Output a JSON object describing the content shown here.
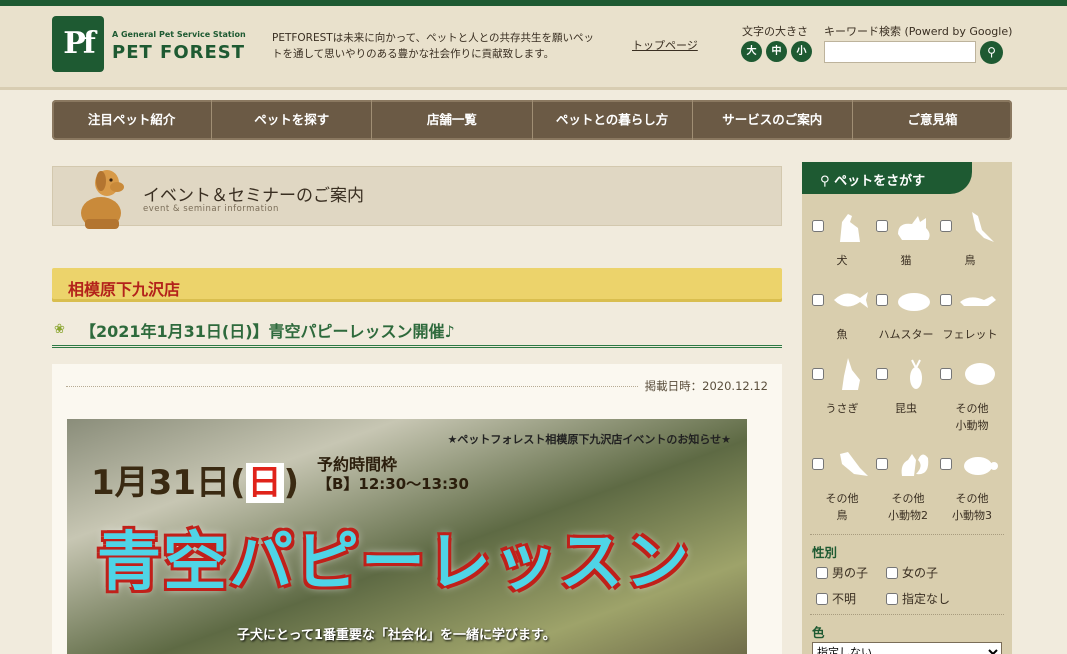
{
  "header": {
    "logo_tag": "A General Pet Service Station",
    "logo_name": "PET FOREST",
    "logo_mark": "Pf",
    "tagline": "PETFORESTは未来に向かって、ペットと人との共存共生を願いペットを通して思いやりのある豊かな社会作りに貢献致します。",
    "top_link": "トップページ",
    "font_size_label": "文字の大きさ",
    "font_sizes": [
      "大",
      "中",
      "小"
    ],
    "keyword_label": "キーワード検索 (Powerd by Google)",
    "keyword_value": ""
  },
  "nav": [
    "注目ペット紹介",
    "ペットを探す",
    "店舗一覧",
    "ペットとの暮らし方",
    "サービスのご案内",
    "ご意見箱"
  ],
  "main": {
    "banner_title": "イベント＆セミナーのご案内",
    "banner_sub": "event & seminar information",
    "store_name": "相模原下九沢店",
    "event_title": "【2021年1月31日(日)】青空パピーレッスン開催♪",
    "post_date": "掲載日時：2020.12.12",
    "flyer": {
      "top": "★ペットフォレスト相模原下九沢店イベントのお知らせ★",
      "date_prefix": "1月31日(",
      "date_day": "日",
      "date_suffix": ")",
      "slot_label": "予約時間枠",
      "slot_time": "【B】12:30～13:30",
      "main": "青空パピーレッスン",
      "caption": "子犬にとって1番重要な「社会化」を一緒に学びます。"
    }
  },
  "sidebar": {
    "head": "ペットをさがす",
    "pets": [
      {
        "label": "犬",
        "icon": "dog-icon"
      },
      {
        "label": "猫",
        "icon": "cat-icon"
      },
      {
        "label": "鳥",
        "icon": "bird-icon"
      },
      {
        "label": "魚",
        "icon": "fish-icon"
      },
      {
        "label": "ハムスター",
        "icon": "hamster-icon"
      },
      {
        "label": "フェレット",
        "icon": "ferret-icon"
      },
      {
        "label": "うさぎ",
        "icon": "rabbit-icon"
      },
      {
        "label": "昆虫",
        "icon": "insect-icon"
      },
      {
        "label": "その他小動物",
        "icon": "small-animal-icon"
      },
      {
        "label": "その他鳥",
        "icon": "other-bird-icon"
      },
      {
        "label": "その他小動物2",
        "icon": "squirrel-icon"
      },
      {
        "label": "その他小動物3",
        "icon": "turtle-icon"
      }
    ],
    "gender_label": "性別",
    "gender_options": [
      "男の子",
      "女の子",
      "不明",
      "指定なし"
    ],
    "color_label": "色",
    "color_selected": "指定しない"
  },
  "colors": {
    "brand_green": "#1e5a32",
    "nav_brown": "#6b5a45",
    "store_yellow": "#ecd36b",
    "store_red": "#b3221b"
  }
}
